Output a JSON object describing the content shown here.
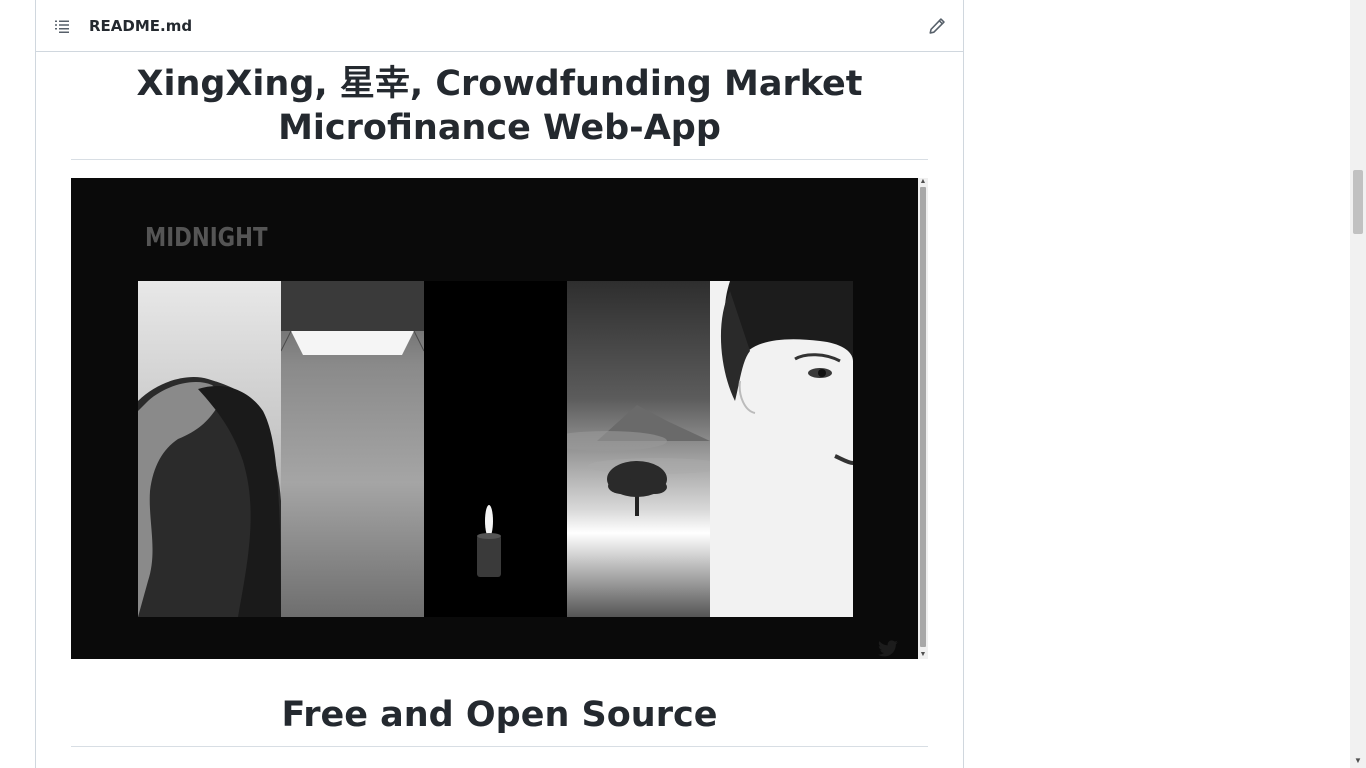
{
  "readme": {
    "filename": "README.md",
    "toc_icon": "list-unordered-icon",
    "edit_icon": "pencil-icon"
  },
  "content": {
    "title_line1": "XingXing, 星幸, Crowdfunding Market",
    "title_line2": "Microfinance Web-App",
    "section_heading": "Free and Open Source"
  },
  "preview": {
    "brand": "MIDNIGHT",
    "panels": [
      "woman-profile",
      "ceiling-light",
      "candle",
      "mountain-tree",
      "woman-face"
    ],
    "social_icon": "twitter-icon"
  }
}
